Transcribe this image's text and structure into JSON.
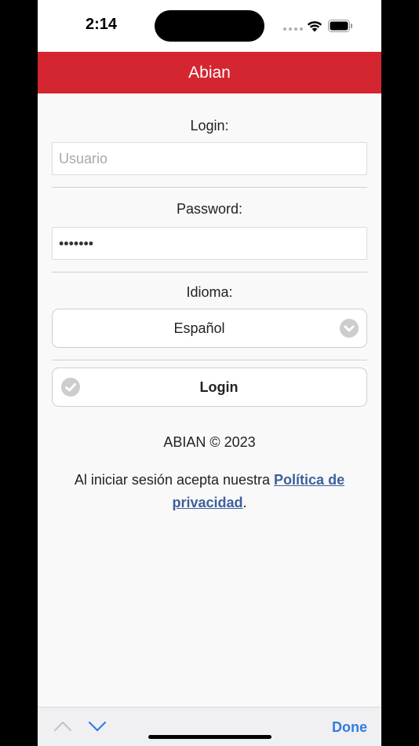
{
  "status_bar": {
    "time": "2:14"
  },
  "header": {
    "title": "Abian"
  },
  "form": {
    "login_label": "Login:",
    "login_placeholder": "Usuario",
    "login_value": "",
    "password_label": "Password:",
    "password_value": "1234567",
    "language_label": "Idioma:",
    "language_selected": "Español",
    "submit_label": "Login"
  },
  "footer": {
    "copyright": "ABIAN © 2023",
    "privacy_prefix": "Al iniciar sesión acepta nuestra ",
    "privacy_link": "Política de privacidad",
    "privacy_suffix": "."
  },
  "accessory": {
    "done_label": "Done"
  },
  "colors": {
    "header_bg": "#d42630",
    "link": "#3e5f9c",
    "done": "#2f7de1"
  },
  "icons": {
    "select_indicator": "chevron-down-circle-icon",
    "login_indicator": "check-circle-icon",
    "prev": "chevron-up-icon",
    "next": "chevron-down-icon"
  }
}
